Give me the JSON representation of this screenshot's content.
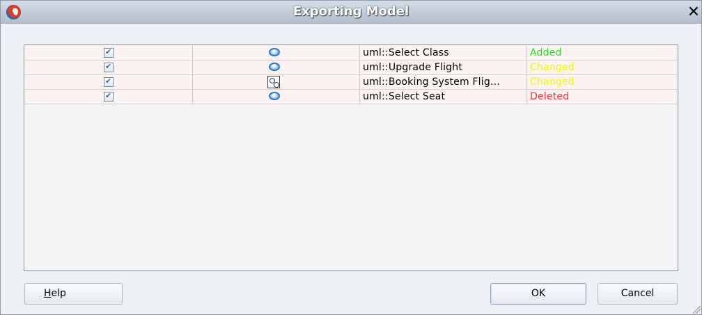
{
  "window": {
    "title": "Exporting Model"
  },
  "table": {
    "rows": [
      {
        "checked": true,
        "icon": "use-case-oval-icon",
        "name": "uml::Select Class",
        "status": "Added",
        "status_color": "#22e022"
      },
      {
        "checked": true,
        "icon": "use-case-oval-icon",
        "name": "uml::Upgrade Flight",
        "status": "Changed",
        "status_color": "#f5f500"
      },
      {
        "checked": true,
        "icon": "collaboration-icon",
        "name": "uml::Booking System Flig...",
        "status": "Changed",
        "status_color": "#f5f500"
      },
      {
        "checked": true,
        "icon": "use-case-oval-icon",
        "name": "uml::Select Seat",
        "status": "Deleted",
        "status_color": "#ff2b2b"
      }
    ]
  },
  "buttons": {
    "help_prefix": "H",
    "help_rest": "elp",
    "ok": "OK",
    "cancel": "Cancel"
  },
  "icons": {
    "app": "oracle-jdeveloper-app-icon",
    "close": "close-icon",
    "row_checkbox": "checkbox-checked-icon"
  }
}
